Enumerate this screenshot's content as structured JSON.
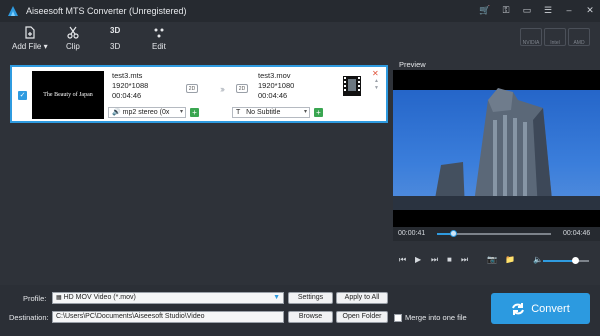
{
  "app": {
    "title": "Aiseesoft MTS Converter (Unregistered)",
    "window_controls": [
      "cart-icon",
      "key-icon",
      "feedback-icon",
      "menu-icon",
      "minimize-icon",
      "close-icon"
    ]
  },
  "toolbar": {
    "add_file": "Add File",
    "clip": "Clip",
    "three_d": "3D",
    "edit": "Edit",
    "hw_accel": [
      "NVIDIA",
      "Intel",
      "AMD"
    ]
  },
  "file_item": {
    "checked": true,
    "thumbnail_text": "The Beauty of Japan",
    "source": {
      "name": "test3.mts",
      "resolution": "1920*1088",
      "duration": "00:04:46",
      "badge": "2D"
    },
    "output": {
      "name": "test3.mov",
      "resolution": "1920*1080",
      "duration": "00:04:46",
      "badge": "2D"
    },
    "audio_track": "mp2 stereo (0x",
    "subtitle": "No Subtitle",
    "subtitle_prefix": "T"
  },
  "preview": {
    "label": "Preview",
    "current_time": "00:00:41",
    "total_time": "00:04:46",
    "progress": 0.14,
    "volume": 0.7
  },
  "bottom": {
    "profile_label": "Profile:",
    "profile_value": "HD MOV Video (*.mov)",
    "settings": "Settings",
    "apply_to_all": "Apply to All",
    "destination_label": "Destination:",
    "destination_value": "C:\\Users\\PC\\Documents\\Aiseesoft Studio\\Video",
    "browse": "Browse",
    "open_folder": "Open Folder",
    "merge_label": "Merge into one file",
    "merge_checked": false,
    "convert": "Convert"
  },
  "colors": {
    "accent": "#2f9be0",
    "background": "#2e3239",
    "add": "#3aa651",
    "remove": "#e0533a"
  }
}
